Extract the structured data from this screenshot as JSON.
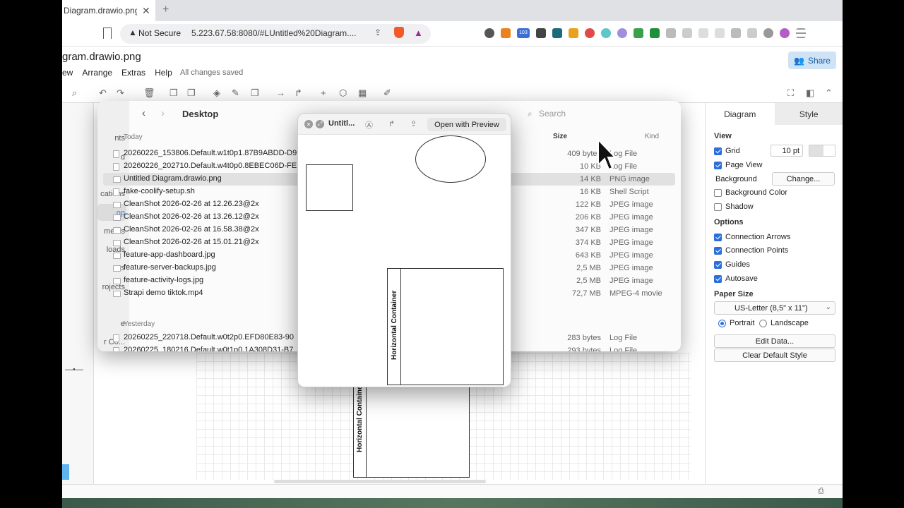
{
  "browser": {
    "tab_title": "Diagram.drawio.png -",
    "tab_close": "✕",
    "new_tab": "+",
    "security_label": "Not Secure",
    "url": "5.223.67.58:8080/#LUntitled%20Diagram....",
    "extension_badge": "103"
  },
  "app": {
    "title": "gram.drawio.png",
    "menus": [
      "ew",
      "Arrange",
      "Extras",
      "Help"
    ],
    "save_status": "All changes saved",
    "share_label": "Share"
  },
  "canvas": {
    "container_label": "Horizontal Containe"
  },
  "format_panel": {
    "tabs": [
      "Diagram",
      "Style"
    ],
    "view_header": "View",
    "grid_label": "Grid",
    "grid_size": "10 pt",
    "page_view_label": "Page View",
    "background_label": "Background",
    "change_button": "Change...",
    "background_color_label": "Background Color",
    "shadow_label": "Shadow",
    "options_header": "Options",
    "connection_arrows_label": "Connection Arrows",
    "connection_points_label": "Connection Points",
    "guides_label": "Guides",
    "autosave_label": "Autosave",
    "paper_size_header": "Paper Size",
    "paper_size_value": "US-Letter (8,5\" x 11\")",
    "portrait_label": "Portrait",
    "landscape_label": "Landscape",
    "edit_data_button": "Edit Data...",
    "clear_style_button": "Clear Default Style"
  },
  "finder": {
    "location": "Desktop",
    "search_placeholder": "Search",
    "col_size": "Size",
    "col_kind": "Kind",
    "sidebar": [
      "nts",
      "d",
      "cations",
      "op",
      "ments",
      "loads",
      "cts",
      "rojects",
      "e",
      "r Co..."
    ],
    "section_today": "Today",
    "section_yesterday": "Yesterday",
    "files_today": [
      {
        "name": "20260226_153806.Default.w1t0p1.87B9ABDD-D9",
        "size": "409 bytes",
        "kind": "Log File"
      },
      {
        "name": "20260226_202710.Default.w4t0p0.8EBEC06D-FE",
        "size": "10 KB",
        "kind": "Log File"
      },
      {
        "name": "Untitled Diagram.drawio.png",
        "size": "14 KB",
        "kind": "PNG image"
      },
      {
        "name": "fake-coolify-setup.sh",
        "size": "16 KB",
        "kind": "Shell Script"
      },
      {
        "name": "CleanShot 2026-02-26 at 12.26.23@2x",
        "size": "122 KB",
        "kind": "JPEG image"
      },
      {
        "name": "CleanShot 2026-02-26 at 13.26.12@2x",
        "size": "206 KB",
        "kind": "JPEG image"
      },
      {
        "name": "CleanShot 2026-02-26 at 16.58.38@2x",
        "size": "347 KB",
        "kind": "JPEG image"
      },
      {
        "name": "CleanShot 2026-02-26 at 15.01.21@2x",
        "size": "374 KB",
        "kind": "JPEG image"
      },
      {
        "name": "feature-app-dashboard.jpg",
        "size": "643 KB",
        "kind": "JPEG image"
      },
      {
        "name": "feature-server-backups.jpg",
        "size": "2,5 MB",
        "kind": "JPEG image"
      },
      {
        "name": "feature-activity-logs.jpg",
        "size": "2,5 MB",
        "kind": "JPEG image"
      },
      {
        "name": "Strapi demo tiktok.mp4",
        "size": "72,7 MB",
        "kind": "MPEG-4 movie"
      }
    ],
    "files_yesterday": [
      {
        "name": "20260225_220718.Default.w0t2p0.EFD80E83-90",
        "size": "283 bytes",
        "kind": "Log File"
      },
      {
        "name": "20260225_180216.Default.w0t1p0.1A308D31-B7",
        "size": "293 bytes",
        "kind": "Log File"
      }
    ]
  },
  "quicklook": {
    "title": "Untitl...",
    "open_button": "Open with Preview",
    "container_label": "Horizontal Container"
  },
  "colors": {
    "accent": "#2d6fd8",
    "share_bg": "#cfe3f7"
  }
}
